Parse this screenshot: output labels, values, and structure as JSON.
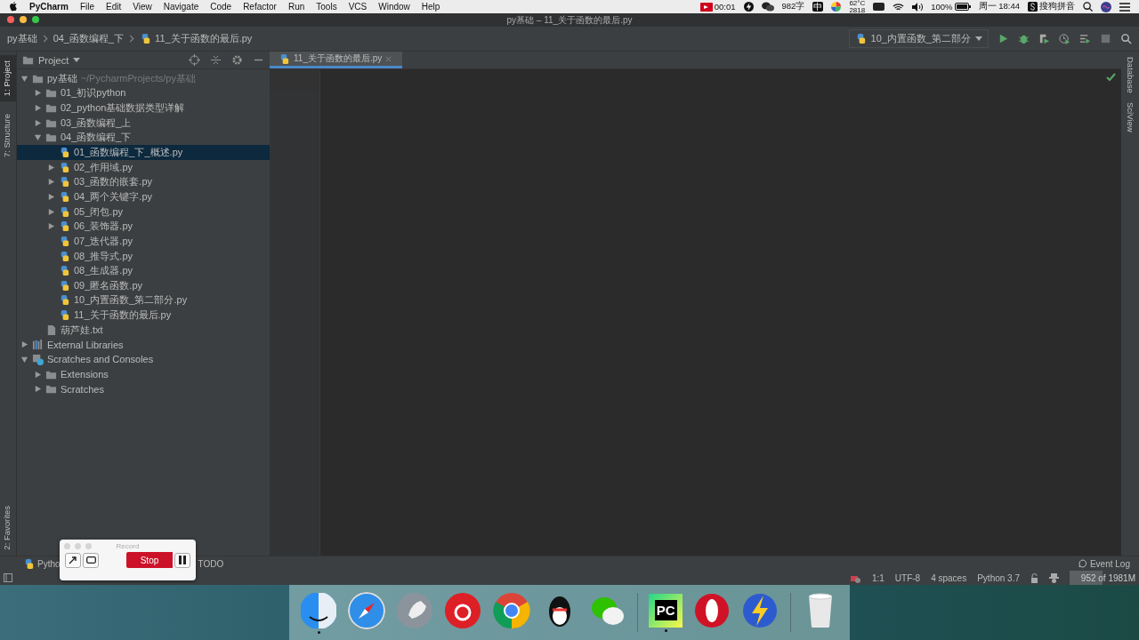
{
  "menubar": {
    "app": "PyCharm",
    "menus": [
      "File",
      "Edit",
      "View",
      "Navigate",
      "Code",
      "Refactor",
      "Run",
      "Tools",
      "VCS",
      "Window",
      "Help"
    ],
    "status_items": [
      {
        "kind": "record",
        "text": "00:01"
      },
      {
        "kind": "bolt"
      },
      {
        "kind": "chat"
      },
      {
        "kind": "text",
        "text": "982字"
      },
      {
        "kind": "ime",
        "text": "中"
      },
      {
        "kind": "wheel"
      },
      {
        "kind": "temp",
        "text": "62°C",
        "text2": "2818"
      },
      {
        "kind": "screen"
      },
      {
        "kind": "wifi"
      },
      {
        "kind": "volume"
      },
      {
        "kind": "battery",
        "text": "100%"
      },
      {
        "kind": "text",
        "text": "周一 18:44"
      },
      {
        "kind": "sogou",
        "text": "搜狗拼音"
      },
      {
        "kind": "search"
      },
      {
        "kind": "siri"
      },
      {
        "kind": "list"
      }
    ]
  },
  "window": {
    "title": "py基础 – 11_关于函数的最后.py"
  },
  "breadcrumbs": [
    {
      "kind": "folder",
      "text": "py基础"
    },
    {
      "kind": "folder",
      "text": "04_函数编程_下"
    },
    {
      "kind": "py",
      "text": "11_关于函数的最后.py"
    }
  ],
  "run_config": {
    "label": "10_内置函数_第二部分"
  },
  "toolbar": [
    {
      "kind": "run",
      "disabled": false
    },
    {
      "kind": "debug",
      "disabled": false
    },
    {
      "kind": "coverage",
      "disabled": false
    },
    {
      "kind": "profile",
      "disabled": false
    },
    {
      "kind": "concurrency",
      "disabled": false
    },
    {
      "kind": "stop",
      "disabled": true
    },
    {
      "kind": "search",
      "disabled": false
    }
  ],
  "left_stripe": [
    {
      "label": "1: Project",
      "selected": true
    },
    {
      "label": "7: Structure",
      "selected": false
    }
  ],
  "left_stripe_bottom": [
    {
      "label": "2: Favorites",
      "selected": false
    }
  ],
  "project_panel": {
    "title": "Project"
  },
  "project_tree": [
    {
      "kind": "folder",
      "text": "py基础",
      "path": "~/PycharmProjects/py基础",
      "expanded": true,
      "selected": false,
      "children": [
        {
          "kind": "folder",
          "text": "01_初识python",
          "expanded": false,
          "selected": false
        },
        {
          "kind": "folder",
          "text": "02_python基础数据类型详解",
          "expanded": false,
          "selected": false
        },
        {
          "kind": "folder",
          "text": "03_函数编程_上",
          "expanded": false,
          "selected": false
        },
        {
          "kind": "folder",
          "text": "04_函数编程_下",
          "expanded": true,
          "selected": false,
          "children": [
            {
              "kind": "py",
              "text": "01_函数编程_下_概述.py",
              "selected": true
            },
            {
              "kind": "py",
              "text": "02_作用域.py",
              "expanded": false,
              "selected": false
            },
            {
              "kind": "py",
              "text": "03_函数的嵌套.py",
              "expanded": false,
              "selected": false
            },
            {
              "kind": "py",
              "text": "04_两个关键字.py",
              "expanded": false,
              "selected": false
            },
            {
              "kind": "py",
              "text": "05_闭包.py",
              "expanded": false,
              "selected": false
            },
            {
              "kind": "py",
              "text": "06_装饰器.py",
              "expanded": false,
              "selected": false
            },
            {
              "kind": "py",
              "text": "07_迭代器.py",
              "selected": false
            },
            {
              "kind": "py",
              "text": "08_推导式.py",
              "selected": false
            },
            {
              "kind": "py",
              "text": "08_生成器.py",
              "selected": false
            },
            {
              "kind": "py",
              "text": "09_匿名函数.py",
              "selected": false
            },
            {
              "kind": "py",
              "text": "10_内置函数_第二部分.py",
              "selected": false
            },
            {
              "kind": "py",
              "text": "11_关于函数的最后.py",
              "selected": false
            }
          ]
        },
        {
          "kind": "txt",
          "text": "葫芦娃.txt",
          "selected": false
        }
      ]
    },
    {
      "kind": "libraries",
      "text": "External Libraries",
      "expanded": false,
      "selected": false
    },
    {
      "kind": "scratches",
      "text": "Scratches and Consoles",
      "expanded": true,
      "selected": false,
      "children": [
        {
          "kind": "folder",
          "text": "Extensions",
          "expanded": false,
          "selected": false
        },
        {
          "kind": "folder",
          "text": "Scratches",
          "expanded": false,
          "selected": false
        }
      ]
    }
  ],
  "editor_tabs": [
    {
      "label": "11_关于函数的最后.py",
      "selected": true
    }
  ],
  "right_stripe": [
    {
      "label": "Database"
    },
    {
      "label": "SciView"
    }
  ],
  "tool_tabs": [
    {
      "label": "Pytho"
    },
    {
      "label": "TODO"
    }
  ],
  "event_log": {
    "label": "Event Log"
  },
  "status_bar": {
    "position": "1:1",
    "encoding": "UTF-8",
    "indent": "4 spaces",
    "interpreter": "Python 3.7",
    "memory": {
      "text": "952 of 1981M",
      "level": 0.48
    }
  },
  "record_window": {
    "title": "Record",
    "stop": "Stop"
  },
  "dock": [
    {
      "kind": "finder",
      "running": true
    },
    {
      "kind": "safari",
      "running": false
    },
    {
      "kind": "launchpad",
      "running": false
    },
    {
      "kind": "music",
      "running": false
    },
    {
      "kind": "chrome",
      "running": false
    },
    {
      "kind": "qq",
      "running": false
    },
    {
      "kind": "wechat",
      "running": false
    },
    {
      "kind": "pycharm",
      "label": "PC",
      "running": true
    },
    {
      "kind": "opera",
      "running": false
    },
    {
      "kind": "bolt",
      "running": false
    },
    {
      "kind": "trash",
      "running": false
    }
  ]
}
